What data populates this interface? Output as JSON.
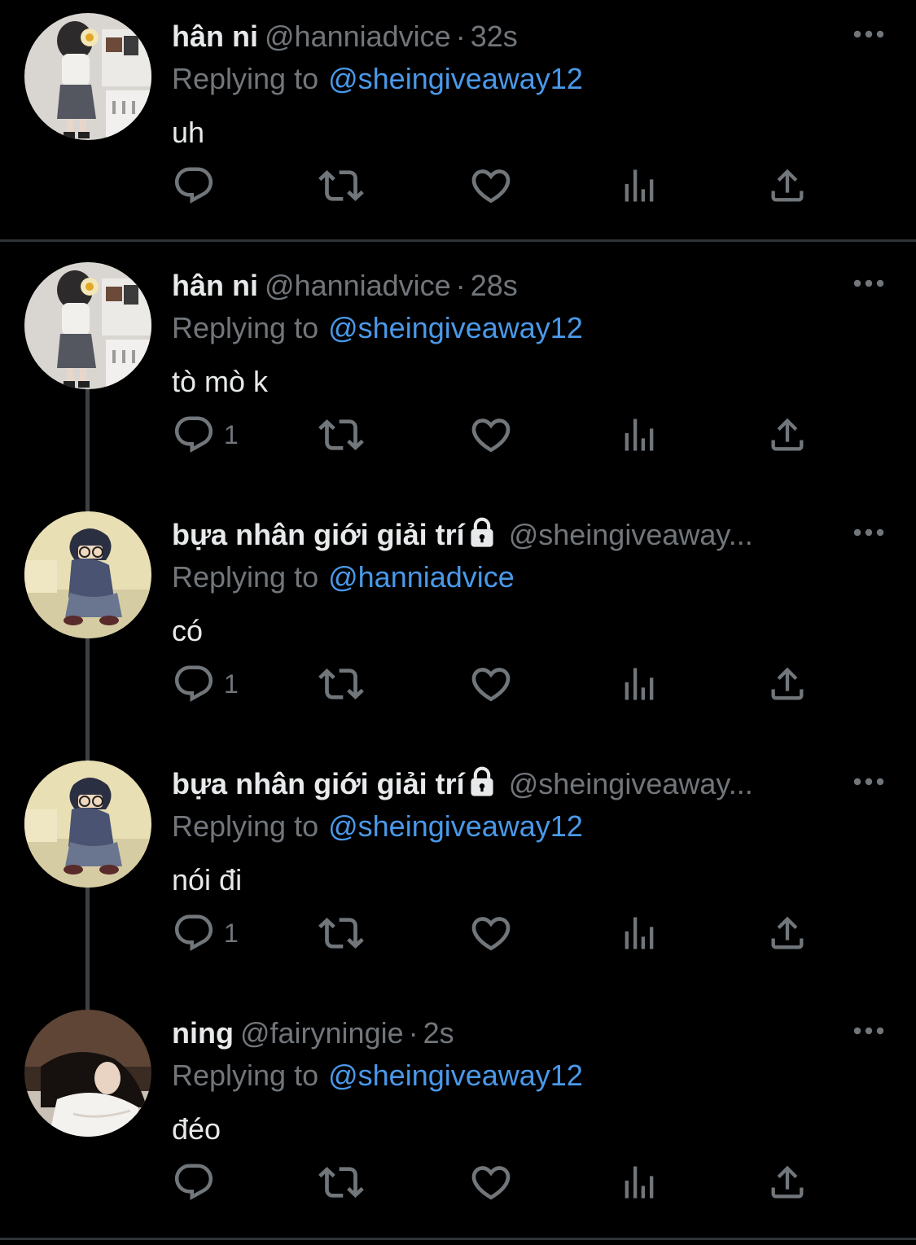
{
  "theme": {
    "accent": "#4a99e9",
    "muted": "#71767b",
    "background": "#000000"
  },
  "tweets": [
    {
      "name": "hân ni",
      "handle": "@hanniadvice",
      "time": "32s",
      "replying_label": "Replying to",
      "replying_to": "@sheingiveaway12",
      "text": "uh",
      "reply_count": "",
      "avatar": "hanni-avatar",
      "locked": false
    },
    {
      "name": "hân ni",
      "handle": "@hanniadvice",
      "time": "28s",
      "replying_label": "Replying to",
      "replying_to": "@sheingiveaway12",
      "text": "tò mò k",
      "reply_count": "1",
      "avatar": "hanni-avatar",
      "locked": false
    },
    {
      "name": "bựa nhân giới giải trí",
      "handle": "@sheingiveaway...",
      "time": "",
      "replying_label": "Replying to",
      "replying_to": "@hanniadvice",
      "text": "có",
      "reply_count": "1",
      "avatar": "conan-avatar",
      "locked": true
    },
    {
      "name": "bựa nhân giới giải trí",
      "handle": "@sheingiveaway...",
      "time": "",
      "replying_label": "Replying to",
      "replying_to": "@sheingiveaway12",
      "text": "nói đi",
      "reply_count": "1",
      "avatar": "conan-avatar",
      "locked": true
    },
    {
      "name": "ning",
      "handle": "@fairyningie",
      "time": "2s",
      "replying_label": "Replying to",
      "replying_to": "@sheingiveaway12",
      "text": "đéo",
      "reply_count": "",
      "avatar": "ning-avatar",
      "locked": false
    }
  ]
}
